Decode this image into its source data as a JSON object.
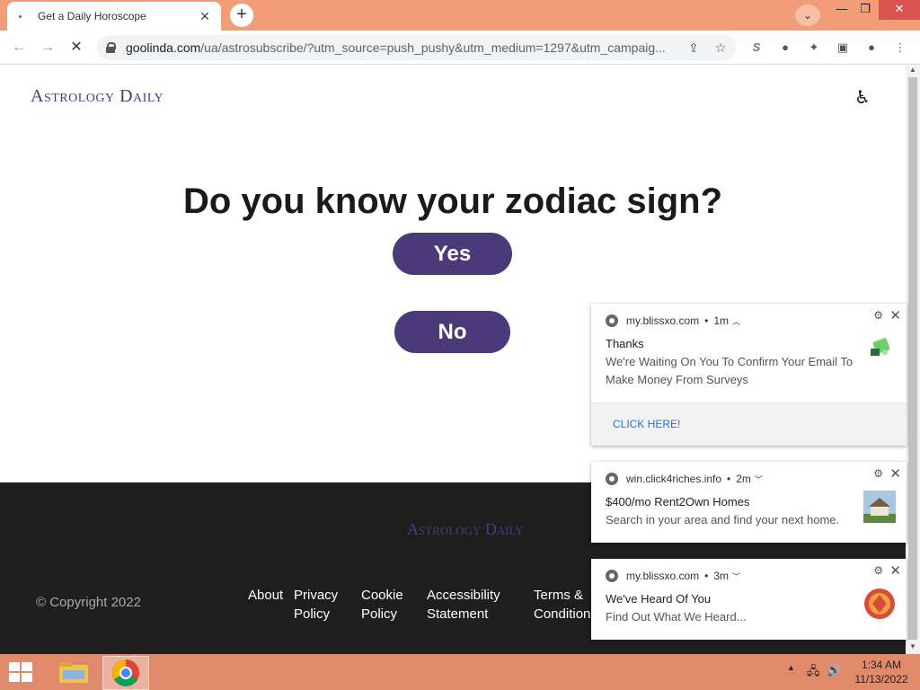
{
  "browser": {
    "tab_title": "Get a Daily Horoscope",
    "url_host": "goolinda.com",
    "url_path": "/ua/astrosubscribe/?utm_source=push_pushy&utm_medium=1297&utm_campaig..."
  },
  "site": {
    "logo": "Astrology Daily",
    "question": "Do you know your zodiac sign?",
    "yes_label": "Yes",
    "no_label": "No"
  },
  "footer": {
    "logo": "Astrology Daily",
    "copyright": "© Copyright 2022",
    "links": [
      {
        "line1": "About",
        "line2": ""
      },
      {
        "line1": "Privacy",
        "line2": "Policy"
      },
      {
        "line1": "Cookie",
        "line2": "Policy"
      },
      {
        "line1": "Accessibility",
        "line2": "Statement"
      },
      {
        "line1": "Terms &",
        "line2": "Condition"
      }
    ]
  },
  "notifications": [
    {
      "source": "my.blissxo.com",
      "age": "1m",
      "title": "Thanks",
      "body_line1": "We're Waiting On You To Confirm Your Email To",
      "body_line2": "Make Money From Surveys",
      "action": "CLICK HERE!"
    },
    {
      "source": "win.click4riches.info",
      "age": "2m",
      "title": "$400/mo Rent2Own Homes",
      "body_line1": "Search in your area and find your next home.",
      "body_line2": ""
    },
    {
      "source": "my.blissxo.com",
      "age": "3m",
      "title": "We've Heard Of You",
      "body_line1": "Find Out What We Heard...",
      "body_line2": ""
    }
  ],
  "taskbar": {
    "time": "1:34 AM",
    "date": "11/13/2022"
  },
  "colors": {
    "brand_purple": "#4b3a7a",
    "titlebar": "#f09d78",
    "taskbar": "#e08a6c"
  }
}
